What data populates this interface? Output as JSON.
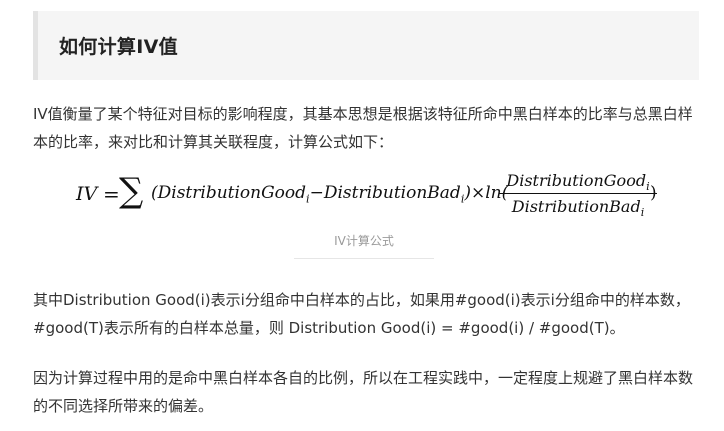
{
  "heading": {
    "title": "如何计算IV值"
  },
  "paragraphs": {
    "intro": "IV值衡量了某个特征对目标的影响程度，其基本思想是根据该特征所命中黑白样本的比率与总黑白样本的比率，来对比和计算其关联程度，计算公式如下：",
    "definition": "其中Distribution Good(i)表示i分组命中白样本的占比，如果用#good(i)表示i分组命中的样本数，#good(T)表示所有的白样本总量，则 Distribution Good(i) = #good(i) / #good(T)。",
    "reason": "因为计算过程中用的是命中黑白样本各自的比例，所以在工程实践中，一定程度上规避了黑白样本数的不同选择所带来的偏差。"
  },
  "formula": {
    "lhs": "IV",
    "equals": "=",
    "sum": "∑",
    "good_term": "(DistributionGood",
    "minus": "−",
    "bad_term": "DistributionBad",
    "times_ln": ")×ln(",
    "numerator": "DistributionGood",
    "denominator": "DistributionBad",
    "subscript": "i",
    "close_paren": ")"
  },
  "caption": {
    "text": "IV计算公式"
  }
}
